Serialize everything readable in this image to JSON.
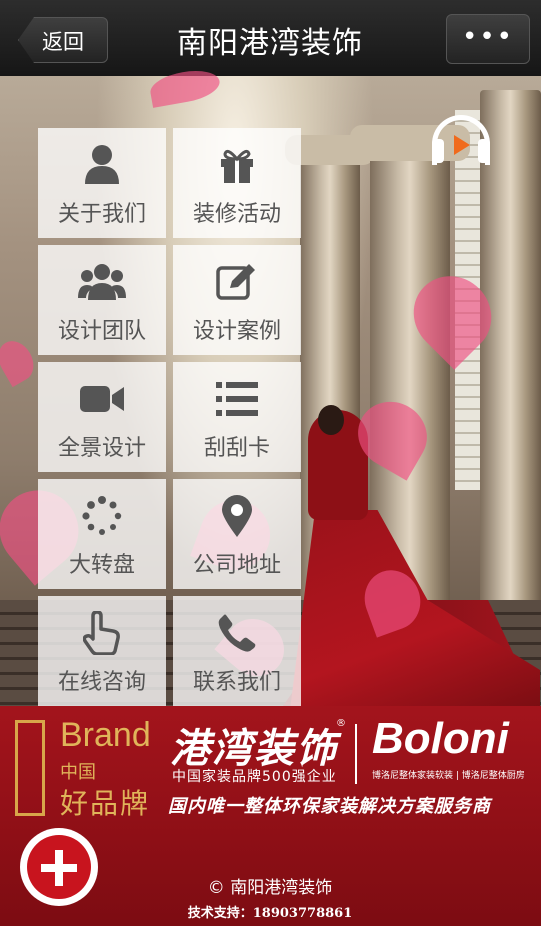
{
  "nav": {
    "back_label": "返回",
    "title": "南阳港湾装饰",
    "more_label": "•••"
  },
  "menu": [
    {
      "label": "关于我们",
      "icon": "user-icon"
    },
    {
      "label": "装修活动",
      "icon": "gift-icon"
    },
    {
      "label": "设计团队",
      "icon": "team-icon"
    },
    {
      "label": "设计案例",
      "icon": "edit-icon"
    },
    {
      "label": "全景设计",
      "icon": "video-camera-icon"
    },
    {
      "label": "刮刮卡",
      "icon": "list-icon"
    },
    {
      "label": "大转盘",
      "icon": "spinner-icon"
    },
    {
      "label": "公司地址",
      "icon": "map-pin-icon"
    },
    {
      "label": "在线咨询",
      "icon": "pointer-hand-icon"
    },
    {
      "label": "联系我们",
      "icon": "phone-icon"
    }
  ],
  "banner": {
    "brand_en": "Brand",
    "brand_cn_top": "中国",
    "brand_cn_bottom": "好品牌",
    "logo_text": "港湾装饰",
    "logo_reg": "®",
    "logo_sub": "中国家装品牌500强企业",
    "boloni": "Boloni",
    "boloni_sub": "博洛尼整体家装软装 | 博洛尼整体厨房",
    "slogan": "国内唯一整体环保家装解决方案服务商"
  },
  "footer": {
    "copyright": "© 南阳港湾装饰",
    "support": "技术支持：18903778861"
  },
  "colors": {
    "banner_red": "#9c121a",
    "gold": "#e0b45a",
    "tile_bg": "rgba(255,255,255,0.78)",
    "icon_gray": "#555555",
    "play_orange": "#f06a1c"
  }
}
